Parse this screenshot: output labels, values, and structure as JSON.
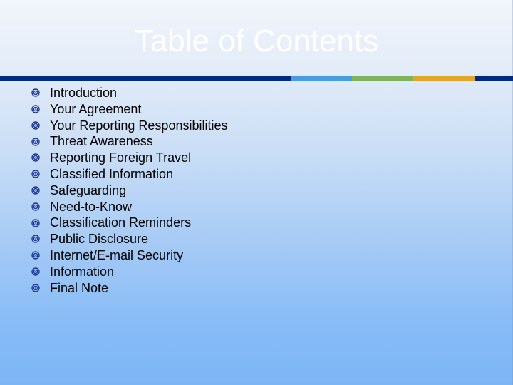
{
  "slide": {
    "title": "Table of Contents",
    "rule_colors": [
      "#002a80",
      "#4a9ce0",
      "#7db35c",
      "#e2a52a",
      "#002a80"
    ],
    "bullet_icon": "bullseye-icon",
    "bullet_color": "#1f3a93",
    "items": [
      "Introduction",
      "Your Agreement",
      "Your Reporting Responsibilities",
      "Threat Awareness",
      "Reporting Foreign Travel",
      "Classified Information",
      "Safeguarding",
      "Need-to-Know",
      "Classification Reminders",
      "Public Disclosure",
      "Internet/E-mail Security",
      "Information",
      "Final Note"
    ]
  }
}
